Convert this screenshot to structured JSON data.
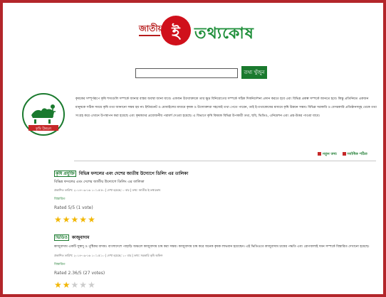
{
  "logo": {
    "prefix": "জাতীয়",
    "circle_letter": "ই",
    "rest": "তথ্যকোষ"
  },
  "search": {
    "value": "",
    "button_label": "তথ্য খুঁজুন"
  },
  "intro": {
    "logo_text": "কৃষি উন্নয়ন",
    "text": "কৃষকের সম্পূর্ণরূপে কৃষি শস্যগুলি সম্পর্কে জানার বাস্তব অবস্থা জানা যাবে। একজন উদ্যোক্তাকে তার ক্ষুদ্র বিনিয়োগের সম্পর্কে সঠিক দিকনির্দেশনা প্রদান করতে হবে এবং বিভিন্ন প্রকল্প সম্পর্কে জানতে হবে। কিন্তু প্রতিনিয়ত একজন মানুষকে সঠিক সময়ে কৃষি তথ্য জানানো সম্ভব হয় না। ইন্টারনেট ও মোবাইলের মাধ্যমে কৃষক ও উদ্যোক্তারা সহজেই তথ্য পেতে পারেন, তাই ই-তথ্যকোষের মাধ্যমে কৃষি উন্নয়ন সম্ভব। বিভিন্ন সরকারি ও বেসরকারি প্রতিষ্ঠানসমূহ থেকে তথ্য সংগ্রহ করে এখানে উপস্থাপন করা হয়েছে এবং কৃষকদের প্রয়োজনীয় পরামর্শ দেওয়া হয়েছে। এ বিভাগে কৃষি বিষয়ক বিভিন্ন উপকারী তথ্য, ছবি, ভিডিও, এনিমেশন এবং প্রশ্ন-উত্তর পাওয়া যাবে।"
  },
  "top_links": [
    "নতুন তথ্য",
    "সর্বাধিক পঠিত"
  ],
  "entries": [
    {
      "category": "কৃষি প্রযুক্তি",
      "title": "বিভিন্ন ফসলের এবং দেশের জাতীয় উদ্যোগে ডিলিং এর তালিকা",
      "subtitle": "বিভিন্ন ফসলের এবং দেশের জাতীয় উদ্যোগে ডিলিং এর তালিকা",
      "body": "",
      "meta": "প্রকাশিত তারিখ: ২০১৪-০৯-১৬ ১০:১৫:৫০ | দেখা হয়েছে: ০ বার | তথ্য: জাতীয় ই-তথ্যকোষ",
      "link": "বিস্তারিত",
      "rated": "Rated 5/5 (1 vote)",
      "rating": 5
    },
    {
      "category": "ভিডিও",
      "title": "কাজুবাদাম",
      "subtitle": "",
      "body": "কাজুবাদাম একটি সুস্বাদু ও পুষ্টিকর বাদাম। বাংলাদেশে পাহাড়ি অঞ্চলে কাজুবাদাম চাষ করা সম্ভব। কাজুবাদাম চাষ করে অনেক কৃষক লাভবান হয়েছেন। এই ভিডিওতে কাজুবাদাম চাষের পদ্ধতি এবং রোগবালাই দমন সম্পর্কে বিস্তারিত দেখানো হয়েছে।",
      "meta": "প্রকাশিত তারিখ: ২০১৪-০৯-১৬ ১০:১৫:১০ | দেখা হয়েছে: ১০ বার | তথ্য: সরকারি কৃষি অফিস",
      "link": "বিস্তারিত",
      "rated": "Rated 2.36/5 (27 votes)",
      "rating": 2
    }
  ],
  "colors": {
    "frame": "#b3262b",
    "brand_green": "#1a7a2e",
    "logo_red": "#d0101b",
    "star": "#f2b705"
  }
}
